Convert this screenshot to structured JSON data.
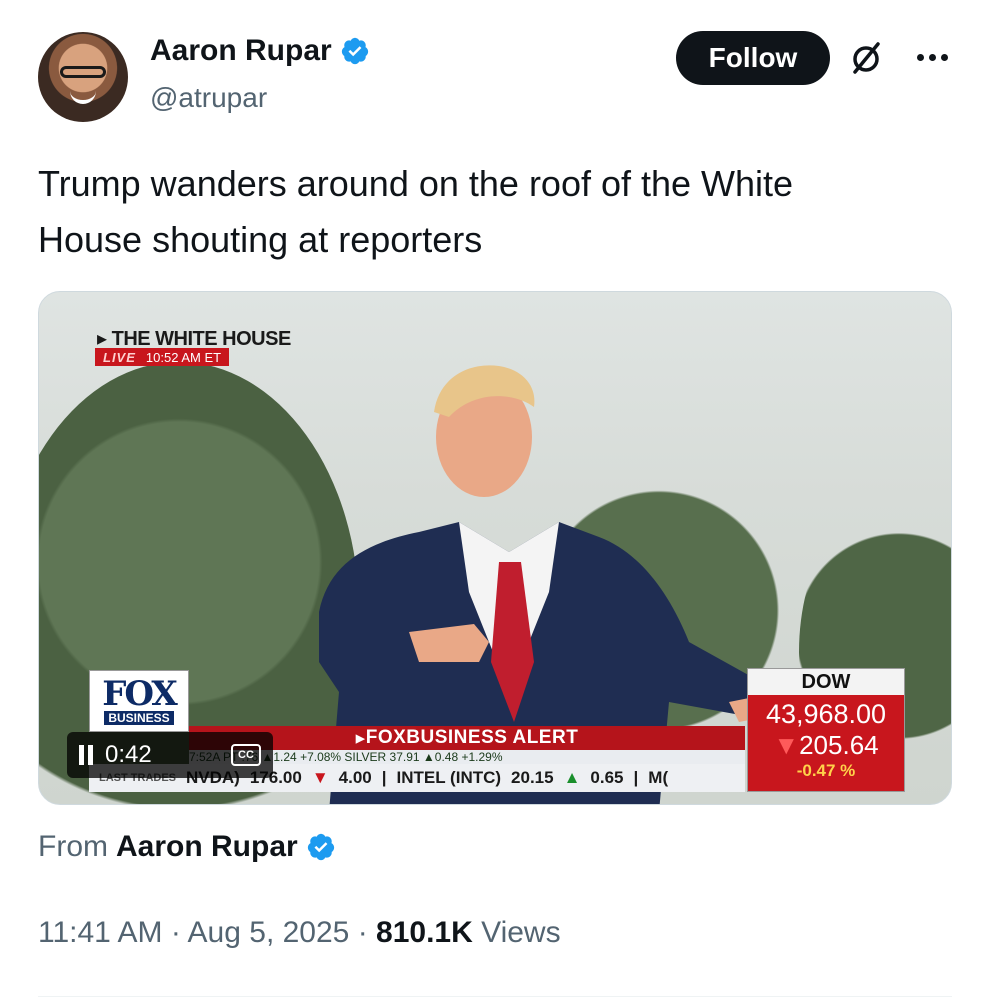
{
  "author": {
    "name": "Aaron Rupar",
    "handle": "@atrupar",
    "verified": true
  },
  "actions": {
    "follow_label": "Follow",
    "grok_icon": "grok-icon",
    "more_icon": "more-options-icon"
  },
  "tweet": {
    "text_line1": "Trump wanders around on the roof of the White",
    "text_line2": "House shouting at reporters"
  },
  "video": {
    "location_tag": "THE WHITE HOUSE",
    "live_label": "LIVE",
    "live_time": "10:52 AM ET",
    "network_logo": "FOX",
    "network_sub": "BUSINESS",
    "alert_banner": "FOXBUSINESS ALERT",
    "ticker_top": "7:52A PT        .76    ▲1.24  +7.08%    SILVER    37.91    ▲0.48   +1.29%",
    "ticker_last_trades": "LAST TRADES",
    "ticker_nvda": "NVDA)",
    "ticker_nvda_price": "176.00",
    "ticker_nvda_chg": "4.00",
    "ticker_intc": "INTEL (INTC)",
    "ticker_intc_price": "20.15",
    "ticker_intc_chg": "0.65",
    "ticker_tail": "M(",
    "dow_label": "DOW",
    "dow_value": "43,968.00",
    "dow_change": "205.64",
    "dow_percent": "-0.47 %",
    "elapsed": "0:42",
    "cc_label": "CC"
  },
  "from_label": "From",
  "from_name": "Aaron Rupar",
  "meta": {
    "time": "11:41 AM",
    "sep1": " · ",
    "date": "Aug 5, 2025",
    "sep2": " · ",
    "views_count": "810.1K",
    "views_label": " Views"
  },
  "colors": {
    "verified_blue": "#1d9bf0",
    "follow_bg": "#0f1419",
    "secondary_text": "#536471",
    "fox_red": "#c8161d"
  }
}
